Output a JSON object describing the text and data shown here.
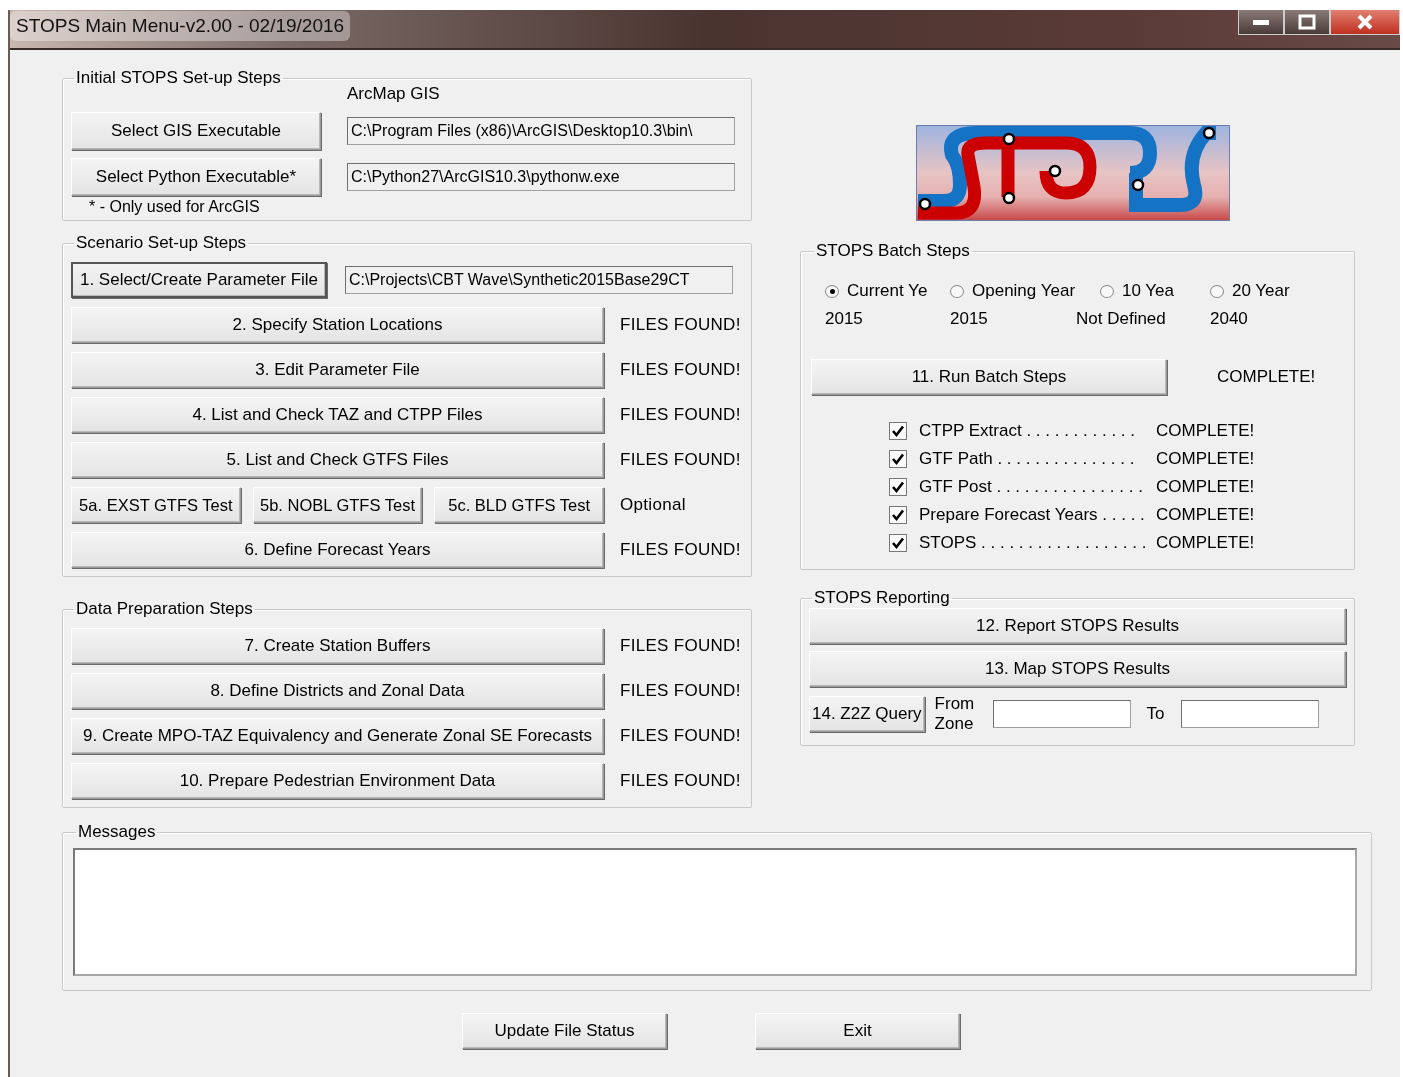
{
  "window": {
    "title": "STOPS Main Menu-v2.00 - 02/19/2016"
  },
  "initial_setup": {
    "title": "Initial STOPS Set-up Steps",
    "field_heading": "ArcMap GIS",
    "rows": [
      {
        "button": "Select GIS Executable",
        "path": "C:\\Program Files (x86)\\ArcGIS\\Desktop10.3\\bin\\"
      },
      {
        "button": "Select Python Executable*",
        "path": "C:\\Python27\\ArcGIS10.3\\pythonw.exe"
      }
    ],
    "footnote": "* - Only used for ArcGIS"
  },
  "scenario_setup": {
    "title": "Scenario Set-up Steps",
    "parameter_button": "1. Select/Create Parameter File",
    "parameter_path": "C:\\Projects\\CBT Wave\\Synthetic2015Base29CT",
    "steps": [
      {
        "kind": "step",
        "label": "2. Specify Station Locations",
        "status": "FILES FOUND!"
      },
      {
        "kind": "step",
        "label": "3. Edit Parameter File",
        "status": "FILES FOUND!"
      },
      {
        "kind": "step",
        "label": "4. List and Check TAZ and CTPP Files",
        "status": "FILES FOUND!"
      },
      {
        "kind": "step",
        "label": "5. List and Check GTFS Files",
        "status": "FILES FOUND!"
      },
      {
        "kind": "tests",
        "buttons": [
          "5a. EXST GTFS Test",
          "5b. NOBL GTFS Test",
          "5c. BLD GTFS Test"
        ],
        "status": "Optional"
      },
      {
        "kind": "step",
        "label": "6. Define Forecast Years",
        "status": "FILES FOUND!"
      }
    ]
  },
  "data_preparation": {
    "title": "Data Preparation Steps",
    "steps": [
      {
        "label": "7. Create Station Buffers",
        "status": "FILES FOUND!"
      },
      {
        "label": "8. Define Districts and Zonal Data",
        "status": "FILES FOUND!"
      },
      {
        "label": "9. Create MPO-TAZ Equivalency and Generate Zonal SE Forecasts",
        "status": "FILES FOUND!"
      },
      {
        "label": "10. Prepare Pedestrian Environment Data",
        "status": "FILES FOUND!"
      }
    ]
  },
  "batch": {
    "title": "STOPS Batch Steps",
    "years": [
      {
        "label": "Current Ye",
        "value": "2015",
        "selected": true
      },
      {
        "label": "Opening Year",
        "value": "2015",
        "selected": false
      },
      {
        "label": "10 Yea",
        "value": "Not Defined",
        "selected": false
      },
      {
        "label": "20 Year",
        "value": "2040",
        "selected": false
      }
    ],
    "run_button": "11. Run Batch Steps",
    "run_status": "COMPLETE!",
    "checks": [
      {
        "label": "CTPP Extract . . . . . . . . . . . .",
        "checked": true,
        "status": "COMPLETE!"
      },
      {
        "label": "GTF Path . . . . . . . . . . . . . . .",
        "checked": true,
        "status": "COMPLETE!"
      },
      {
        "label": "GTF Post . . . . . . . . . . . . . . . .",
        "checked": true,
        "status": "COMPLETE!"
      },
      {
        "label": "Prepare Forecast Years . . . . .",
        "checked": true,
        "status": "COMPLETE!"
      },
      {
        "label": "STOPS . . . . . . . . . . . . . . . . . .",
        "checked": true,
        "status": "COMPLETE!"
      }
    ]
  },
  "reporting": {
    "title": "STOPS Reporting",
    "buttons": [
      "12. Report STOPS Results",
      "13. Map STOPS Results"
    ],
    "query_button": "14. Z2Z Query",
    "from_label": "From Zone",
    "to_label": "To"
  },
  "messages": {
    "title": "Messages"
  },
  "footer_buttons": [
    "Update File Status",
    "Exit"
  ]
}
